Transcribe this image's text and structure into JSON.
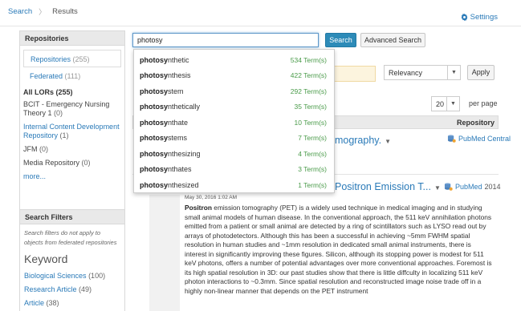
{
  "breadcrumb": {
    "home": "Search",
    "separator": "〉",
    "current": "Results"
  },
  "settings": {
    "label": "Settings",
    "icon": "gear-icon"
  },
  "sidebar": {
    "repositories_title": "Repositories",
    "tabs": [
      {
        "label": "Repositories",
        "count": "(255)"
      },
      {
        "label": "Federated",
        "count": "(111)"
      }
    ],
    "lors_heading": "All LORs (255)",
    "lors": [
      {
        "label": "BCIT - Emergency Nursing Theory 1",
        "count": "(0)",
        "link": false
      },
      {
        "label": "Internal Content Development Repository",
        "count": "(1)",
        "link": true
      },
      {
        "label": "JFM",
        "count": "(0)",
        "link": false
      },
      {
        "label": "Media Repository",
        "count": "(0)",
        "link": false
      }
    ],
    "more_label": "more...",
    "filters_title": "Search Filters",
    "filters_note": "Search filters do not apply to objects from federated repositories",
    "keyword_heading": "Keyword",
    "keywords": [
      {
        "label": "Biological Sciences",
        "count": "(100)"
      },
      {
        "label": "Research Article",
        "count": "(49)"
      },
      {
        "label": "Article",
        "count": "(38)"
      }
    ]
  },
  "search": {
    "value": "photosy",
    "button": "Search",
    "advanced_button": "Advanced Search"
  },
  "autocomplete": {
    "prefix": "photosy",
    "items": [
      {
        "rest": "nthetic",
        "count": "534 Term(s)"
      },
      {
        "rest": "nthesis",
        "count": "422 Term(s)"
      },
      {
        "rest": "stem",
        "count": "292 Term(s)"
      },
      {
        "rest": "nthetically",
        "count": "35 Term(s)"
      },
      {
        "rest": "nthate",
        "count": "10 Term(s)"
      },
      {
        "rest": "stems",
        "count": "7 Term(s)"
      },
      {
        "rest": "nthesizing",
        "count": "4 Term(s)"
      },
      {
        "rest": "nthates",
        "count": "3 Term(s)"
      },
      {
        "rest": "nthesized",
        "count": "1 Term(s)"
      }
    ]
  },
  "results": {
    "notice_partial": "h",
    "sort_value": "Relevancy",
    "apply_button": "Apply",
    "per_page_value": "20",
    "per_page_label": "per page",
    "repository_col": "Repository",
    "result1": {
      "title_partial": "omography.",
      "repository": "PubMed Central"
    },
    "result2": {
      "title_partial": "Positron Emission T...",
      "repository": "PubMed",
      "year": "2014",
      "date": "May 30, 2016 1:02 AM",
      "abstract_lead": "Positron",
      "abstract_text": " emission tomography (PET) is a widely used technique in medical imaging and in studying small animal models of human disease. In the conventional approach, the 511 keV annihilation photons emitted from a patient or small animal are detected by a ring of scintillators such as LYSO read out by arrays of photodetectors. Although this has been a successful in achieving ~5mm FWHM spatial resolution in human studies and ~1mm resolution in dedicated small animal instruments, there is interest in significantly improving these figures. Silicon, although its stopping power is modest for 511 keV photons, offers a number of potential advantages over more conventional approaches. Foremost is its high spatial resolution in 3D: our past studies show that there is little diffculty in localizing 511 keV photon interactions to ~0.3mm. Since spatial resolution and reconstructed image noise trade off in a highly non-linear manner that depends on the PET instrument"
    }
  }
}
